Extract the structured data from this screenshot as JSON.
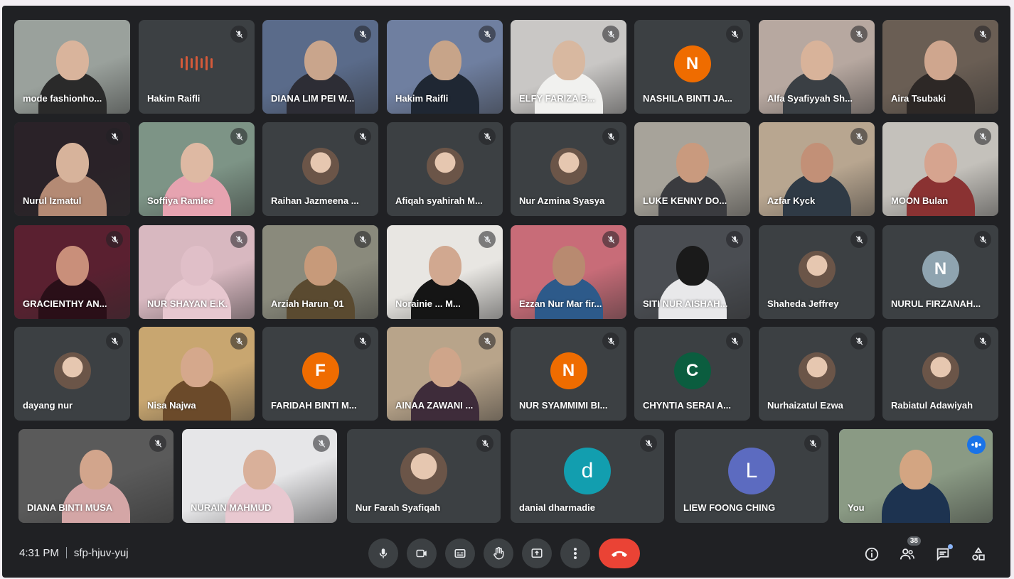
{
  "meeting": {
    "time": "4:31 PM",
    "code": "sfp-hjuv-yuj",
    "participant_count": "38"
  },
  "participants": [
    {
      "name": "mode fashionho...",
      "type": "photo",
      "muted": false
    },
    {
      "name": "Hakim Raifli",
      "type": "audio",
      "muted": true
    },
    {
      "name": "DIANA LIM PEI W...",
      "type": "photo",
      "muted": true
    },
    {
      "name": "Hakim Raifli",
      "type": "photo",
      "muted": true
    },
    {
      "name": "ELFY FARIZA B...",
      "type": "photo",
      "muted": true
    },
    {
      "name": "NASHILA BINTI JA...",
      "type": "initial",
      "initial": "N",
      "color": "#ef6c00",
      "muted": true
    },
    {
      "name": "Alfa Syafiyyah Sh...",
      "type": "photo",
      "muted": true
    },
    {
      "name": "Aira Tsubaki",
      "type": "photo",
      "muted": true
    },
    {
      "name": "Nurul Izmatul",
      "type": "photo",
      "muted": true
    },
    {
      "name": "Soffiya Ramlee",
      "type": "photo",
      "muted": true
    },
    {
      "name": "Raihan Jazmeena ...",
      "type": "avatar-img",
      "muted": true
    },
    {
      "name": "Afiqah syahirah M...",
      "type": "avatar-img",
      "muted": true
    },
    {
      "name": "Nur Azmina Syasya",
      "type": "avatar-img",
      "muted": true
    },
    {
      "name": "LUKE KENNY DO...",
      "type": "photo",
      "muted": false
    },
    {
      "name": "Azfar Kyck",
      "type": "photo",
      "muted": true
    },
    {
      "name": "MOON Bulan",
      "type": "photo",
      "muted": true
    },
    {
      "name": "GRACIENTHY AN...",
      "type": "photo",
      "muted": true
    },
    {
      "name": "NUR SHAYAN E.K.",
      "type": "photo",
      "muted": true
    },
    {
      "name": "Arziah Harun_01",
      "type": "photo",
      "muted": true
    },
    {
      "name": "Norainie ... M...",
      "type": "photo",
      "muted": true
    },
    {
      "name": "Ezzan Nur Mar fir...",
      "type": "photo",
      "muted": true
    },
    {
      "name": "SITI NUR AISHAH...",
      "type": "photo",
      "muted": true
    },
    {
      "name": "Shaheda Jeffrey",
      "type": "avatar-img",
      "muted": true
    },
    {
      "name": "NURUL FIRZANAH...",
      "type": "initial",
      "initial": "N",
      "color": "#8fa4b0",
      "muted": true
    },
    {
      "name": "dayang nur",
      "type": "avatar-img",
      "muted": true
    },
    {
      "name": "Nisa Najwa",
      "type": "photo",
      "muted": true
    },
    {
      "name": "FARIDAH BINTI M...",
      "type": "initial",
      "initial": "F",
      "color": "#ef6c00",
      "muted": true
    },
    {
      "name": "AINAA ZAWANI ...",
      "type": "photo",
      "muted": true
    },
    {
      "name": "NUR SYAMMIMI BI...",
      "type": "initial",
      "initial": "N",
      "color": "#ef6c00",
      "muted": true
    },
    {
      "name": "CHYNTIA SERAI A...",
      "type": "initial",
      "initial": "C",
      "color": "#0b5d3f",
      "muted": true
    },
    {
      "name": "Nurhaizatul Ezwa",
      "type": "avatar-img",
      "muted": true
    },
    {
      "name": "Rabiatul Adawiyah",
      "type": "avatar-img",
      "muted": true
    },
    {
      "name": "DIANA BINTI MUSA",
      "type": "photo",
      "muted": true
    },
    {
      "name": "NURAIN MAHMUD",
      "type": "photo",
      "muted": true
    },
    {
      "name": "Nur Farah Syafiqah",
      "type": "avatar-img",
      "muted": true
    },
    {
      "name": "danial dharmadie",
      "type": "initial",
      "initial": "d",
      "color": "#129eaf",
      "muted": true
    },
    {
      "name": "LIEW FOONG CHING",
      "type": "initial",
      "initial": "L",
      "color": "#5c6bc0",
      "muted": true
    },
    {
      "name": "You",
      "type": "photo",
      "muted": false,
      "speaking": true
    }
  ],
  "controls": [
    {
      "name": "microphone",
      "icon": "microphone-icon"
    },
    {
      "name": "camera",
      "icon": "camera-icon"
    },
    {
      "name": "captions",
      "icon": "captions-icon"
    },
    {
      "name": "raise-hand",
      "icon": "hand-icon"
    },
    {
      "name": "present",
      "icon": "present-icon"
    },
    {
      "name": "more-options",
      "icon": "more-vert-icon"
    },
    {
      "name": "leave-call",
      "icon": "end-call-icon",
      "color": "#ea4335"
    }
  ],
  "right_controls": [
    {
      "name": "meeting-details",
      "icon": "info-icon"
    },
    {
      "name": "people",
      "icon": "people-icon"
    },
    {
      "name": "chat",
      "icon": "chat-icon"
    },
    {
      "name": "activities",
      "icon": "activities-icon"
    }
  ]
}
